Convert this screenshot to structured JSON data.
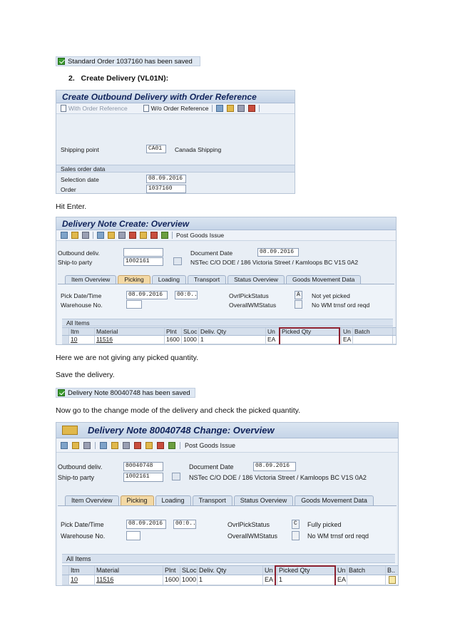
{
  "status1": {
    "text": "Standard Order 1037160 has been saved"
  },
  "heading_vl01n": {
    "number": "2.",
    "text": "Create Delivery (VL01N):"
  },
  "screen1": {
    "title": "Create Outbound Delivery with Order Reference",
    "toolbar": {
      "with_order_ref": "With Order Reference",
      "wo_order_ref": "W/o Order Reference"
    },
    "shipping_point_label": "Shipping point",
    "shipping_point_value": "CA01",
    "shipping_point_desc": "Canada Shipping",
    "sales_order_group": "Sales order data",
    "selection_date_label": "Selection date",
    "selection_date_value": "08.09.2016",
    "order_label": "Order",
    "order_value": "1037160"
  },
  "hit_enter": "Hit Enter.",
  "screen2": {
    "title": "Delivery Note  Create: Overview",
    "post_goods_issue": "Post Goods Issue",
    "outbound_label": "Outbound deliv.",
    "outbound_value": "",
    "ship_to_label": "Ship-to party",
    "ship_to_value": "1002161",
    "doc_date_label": "Document Date",
    "doc_date_value": "08.09.2016",
    "address": "NSTec C/O DOE / 186 Victoria Street / Kamloops BC V1S 0A2",
    "tabs": [
      "Item Overview",
      "Picking",
      "Loading",
      "Transport",
      "Status Overview",
      "Goods Movement Data"
    ],
    "pick_date_label": "Pick Date/Time",
    "pick_date_value": "08.09.2016",
    "pick_time_value": "00:0..",
    "wh_label": "Warehouse No.",
    "ovrl_pick_label": "OvrlPickStatus",
    "ovrl_pick_code": "A",
    "ovrl_pick_desc": "Not yet picked",
    "ovrl_wm_label": "OverallWMStatus",
    "ovrl_wm_desc": "No WM trnsf ord reqd",
    "all_items": "All Items",
    "columns": [
      "Itm",
      "Material",
      "Plnt",
      "SLoc",
      "Deliv. Qty",
      "Un",
      "Picked Qty",
      "Un",
      "Batch"
    ],
    "row": {
      "itm": "10",
      "material": "11516",
      "plnt": "1600",
      "sloc": "1000",
      "qty": "1",
      "un": "EA",
      "picked": "",
      "un2": "EA",
      "batch": ""
    }
  },
  "note1": "Here we are not giving any picked quantity.",
  "note2": "Save the delivery.",
  "status2": {
    "text": "Delivery Note 80040748 has been saved"
  },
  "note3": "Now go to the change mode of the delivery and check the picked quantity.",
  "screen3": {
    "title": "Delivery Note 80040748 Change: Overview",
    "post_goods_issue": "Post Goods Issue",
    "outbound_label": "Outbound deliv.",
    "outbound_value": "80040748",
    "ship_to_label": "Ship-to party",
    "ship_to_value": "1002161",
    "doc_date_label": "Document Date",
    "doc_date_value": "08.09.2016",
    "address": "NSTec C/O DOE / 186 Victoria Street / Kamloops BC V1S 0A2",
    "tabs": [
      "Item Overview",
      "Picking",
      "Loading",
      "Transport",
      "Status Overview",
      "Goods Movement Data"
    ],
    "pick_date_label": "Pick Date/Time",
    "pick_date_value": "08.09.2016",
    "pick_time_value": "00:0..",
    "wh_label": "Warehouse No.",
    "ovrl_pick_label": "OvrlPickStatus",
    "ovrl_pick_code": "C",
    "ovrl_pick_desc": "Fully picked",
    "ovrl_wm_label": "OverallWMStatus",
    "ovrl_wm_desc": "No WM trnsf ord reqd",
    "all_items": "All Items",
    "columns": [
      "Itm",
      "Material",
      "Plnt",
      "SLoc",
      "Deliv. Qty",
      "Un",
      "Picked Qty",
      "Un",
      "Batch",
      "B.."
    ],
    "row": {
      "itm": "10",
      "material": "11516",
      "plnt": "1600",
      "sloc": "1000",
      "qty": "1",
      "un": "EA",
      "picked": "1",
      "un2": "EA",
      "batch": ""
    }
  }
}
